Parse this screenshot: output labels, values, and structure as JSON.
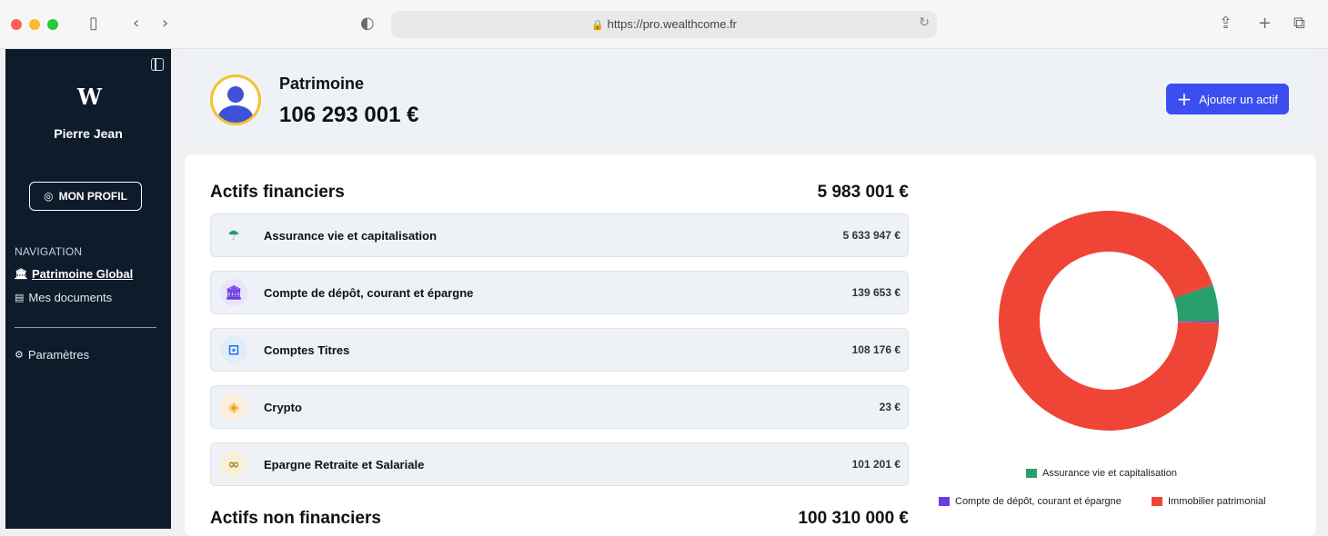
{
  "browser": {
    "url": "https://pro.wealthcome.fr"
  },
  "sidebar": {
    "logo": "W",
    "user_name": "Pierre Jean",
    "profile_button": "MON PROFIL",
    "nav_title": "NAVIGATION",
    "items": [
      {
        "label": "Patrimoine Global",
        "icon": "bank-icon",
        "active": true
      },
      {
        "label": "Mes documents",
        "icon": "document-icon"
      },
      {
        "label": "Paramètres",
        "icon": "settings-icon"
      }
    ]
  },
  "header": {
    "title": "Patrimoine",
    "total": "106 293 001 €",
    "add_button": "Ajouter un actif"
  },
  "financial": {
    "title": "Actifs financiers",
    "total": "5 983 001 €",
    "rows": [
      {
        "label": "Assurance vie et capitalisation",
        "value": "5 633 947 €",
        "icon": "umbrella-icon",
        "color": "#1f9d6c"
      },
      {
        "label": "Compte de dépôt, courant et épargne",
        "value": "139 653 €",
        "icon": "bank-icon",
        "color": "#6e3be0"
      },
      {
        "label": "Comptes Titres",
        "value": "108 176 €",
        "icon": "chart-icon",
        "color": "#1f6fe0"
      },
      {
        "label": "Crypto",
        "value": "23 €",
        "icon": "crypto-icon",
        "color": "#f0a21a"
      },
      {
        "label": "Epargne Retraite et Salariale",
        "value": "101 201 €",
        "icon": "glasses-icon",
        "color": "#b07a10"
      }
    ]
  },
  "non_financial": {
    "title": "Actifs non financiers",
    "total": "100 310 000 €"
  },
  "chart_data": {
    "type": "pie",
    "donut": true,
    "categories": [
      "Assurance vie et capitalisation",
      "Compte de dépôt, courant et épargne",
      "Immobilier patrimonial",
      "Comptes Titres",
      "Epargne Retraite et Salariale",
      "Crypto"
    ],
    "values": [
      5633947,
      139653,
      100310000,
      108176,
      101201,
      23
    ],
    "colors": [
      "#27a06c",
      "#6e3be0",
      "#ef4537",
      "#1f6fe0",
      "#a0640f",
      "#f7c66b"
    ],
    "legend": "bottom"
  }
}
